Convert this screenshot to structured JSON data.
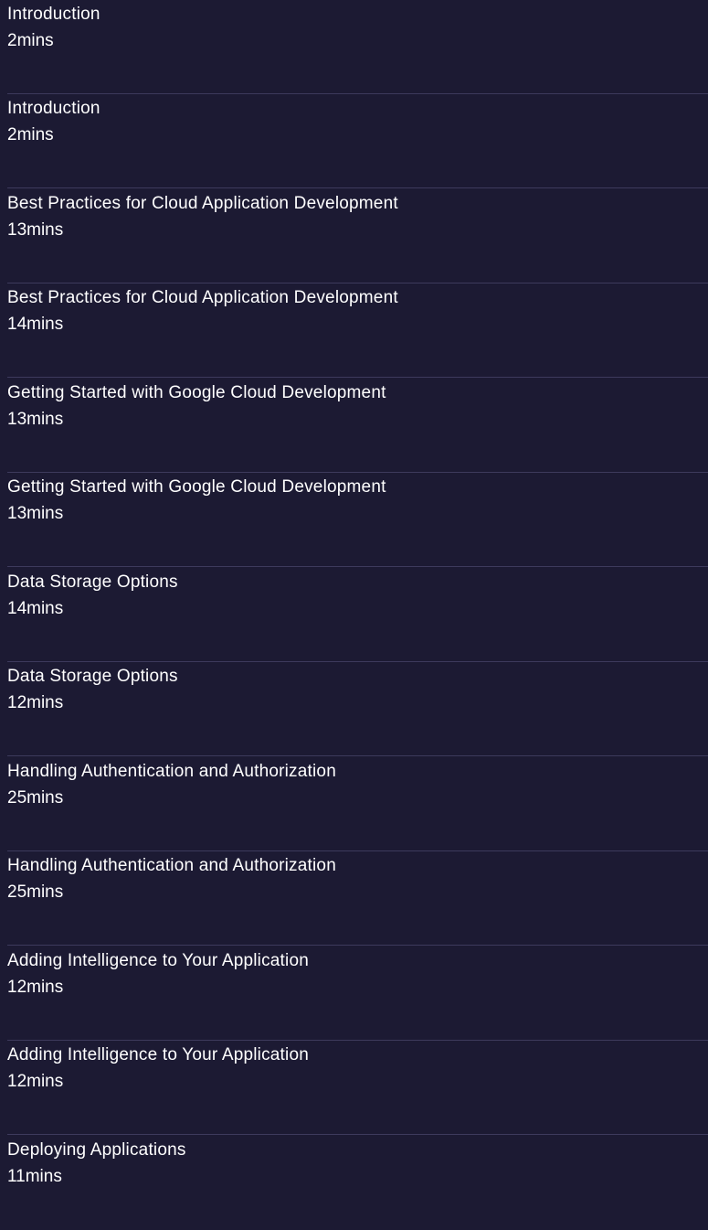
{
  "modules": [
    {
      "title": "Introduction",
      "duration": "2mins"
    },
    {
      "title": "Introduction",
      "duration": "2mins"
    },
    {
      "title": "Best Practices for Cloud Application Development",
      "duration": "13mins"
    },
    {
      "title": "Best Practices for Cloud Application Development",
      "duration": "14mins"
    },
    {
      "title": "Getting Started with Google Cloud Development",
      "duration": "13mins"
    },
    {
      "title": "Getting Started with Google Cloud Development",
      "duration": "13mins"
    },
    {
      "title": "Data Storage Options",
      "duration": "14mins"
    },
    {
      "title": "Data Storage Options",
      "duration": "12mins"
    },
    {
      "title": "Handling Authentication and Authorization",
      "duration": "25mins"
    },
    {
      "title": "Handling Authentication and Authorization",
      "duration": "25mins"
    },
    {
      "title": "Adding Intelligence to Your Application",
      "duration": "12mins"
    },
    {
      "title": "Adding Intelligence to Your Application",
      "duration": "12mins"
    },
    {
      "title": "Deploying Applications",
      "duration": "11mins"
    }
  ],
  "colors": {
    "background": "#1c1a33",
    "divider": "#3d3a5c",
    "text": "#ffffff"
  }
}
